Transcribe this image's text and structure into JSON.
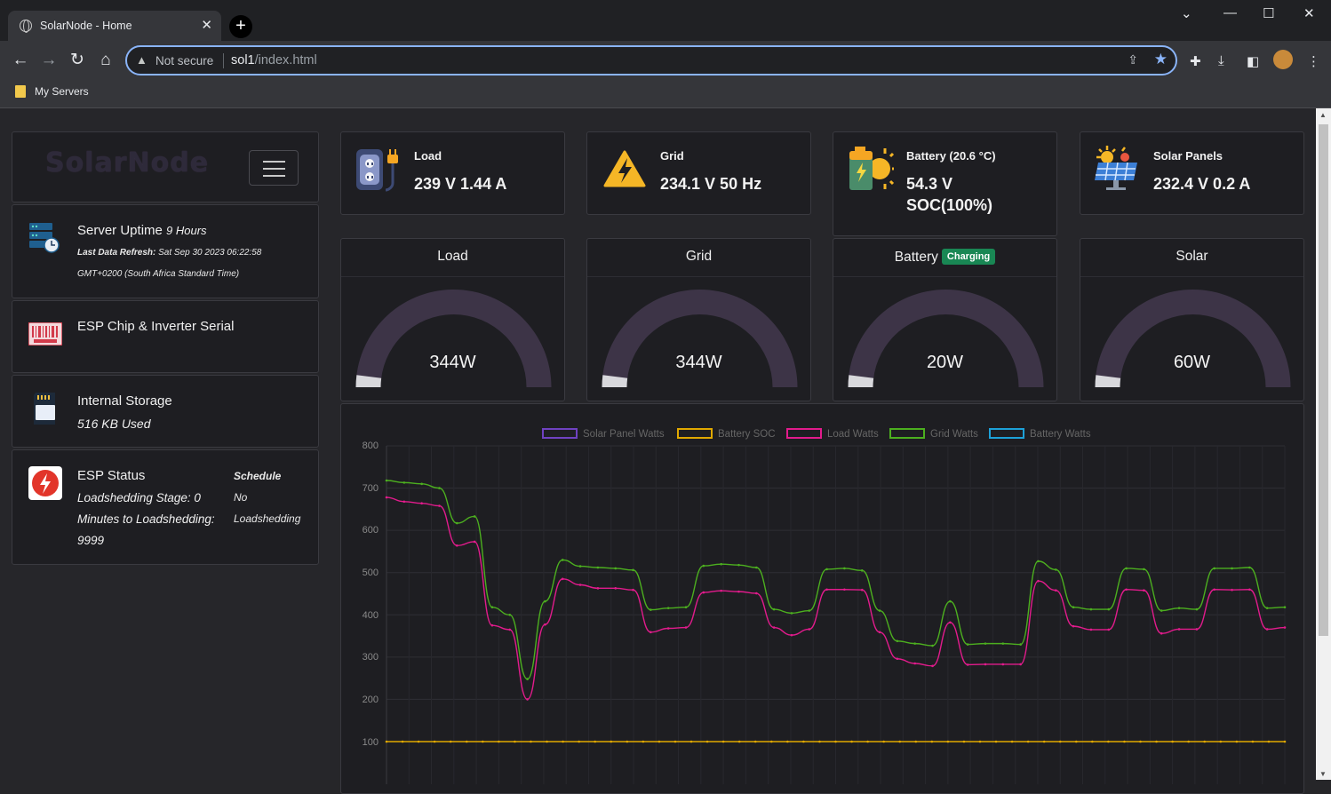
{
  "browser": {
    "tab_title": "SolarNode - Home",
    "tab_close": "✕",
    "new_tab": "+",
    "address_not_secure": "Not secure",
    "address_host": "sol1",
    "address_path": "/index.html",
    "bookmark_label": "My Servers"
  },
  "sidebar": {
    "logo_text": "SolarNode",
    "uptime_label": "Server Uptime",
    "uptime_value": "9 Hours",
    "refresh_label": "Last Data Refresh:",
    "refresh_value": "Sat Sep 30 2023 06:22:58",
    "refresh_tz": "GMT+0200 (South Africa Standard Time)",
    "esp_serial_label": "ESP Chip & Inverter Serial",
    "storage_label": "Internal Storage",
    "storage_value": "516 KB Used",
    "esp_status_label": "ESP Status",
    "loadshedding_stage": "Loadshedding Stage: 0",
    "minutes_label": "Minutes to Loadshedding:",
    "minutes_value": "9999",
    "schedule_label": "Schedule",
    "schedule_value_1": "No",
    "schedule_value_2": "Loadshedding"
  },
  "kpis": [
    {
      "label": "Load",
      "value": "239 V 1.44 A",
      "icon": "plug-outlet-icon"
    },
    {
      "label": "Grid",
      "value": "234.1 V 50 Hz",
      "icon": "high-voltage-icon"
    },
    {
      "label": "Battery (20.6 °C)",
      "value_line1": "54.3 V",
      "value_line2": "SOC(100%)",
      "icon": "battery-sun-icon"
    },
    {
      "label": "Solar Panels",
      "value": "232.4 V 0.2 A",
      "icon": "solar-panel-icon"
    }
  ],
  "gauges": [
    {
      "title": "Load",
      "value_text": "344W",
      "level": 0.0
    },
    {
      "title": "Grid",
      "value_text": "344W",
      "level": 0.0
    },
    {
      "title": "Battery",
      "badge": "Charging",
      "value_text": "20W",
      "level": 0.0
    },
    {
      "title": "Solar",
      "value_text": "60W",
      "level": 0.0
    }
  ],
  "colors": {
    "gauge_track": "#3d3447",
    "solar": "#6f42c1",
    "battery_soc": "#e0a800",
    "load": "#e21b8c",
    "grid": "#4caf1f",
    "battery_watts": "#1da1d8",
    "charging_badge": "#198754"
  },
  "chart_data": {
    "type": "line",
    "ylim": [
      0,
      800
    ],
    "yticks": [
      "800",
      "700",
      "600",
      "500",
      "400",
      "300",
      "200",
      "100"
    ],
    "legend_placement": "top",
    "grid": true,
    "series": [
      {
        "name": "Solar Panel Watts",
        "values": []
      },
      {
        "name": "Battery SOC",
        "values": [
          100,
          100,
          100,
          100,
          100,
          100,
          100,
          100,
          100,
          100,
          100,
          100,
          100,
          100,
          100,
          100,
          100,
          100,
          100,
          100,
          100,
          100,
          100,
          100,
          100,
          100,
          100,
          100,
          100,
          100,
          100,
          100,
          100,
          100,
          100,
          100,
          100,
          100,
          100,
          100,
          100,
          100,
          100,
          100,
          100,
          100,
          100,
          100,
          100,
          100,
          100,
          100,
          100,
          100,
          100,
          100,
          100
        ]
      },
      {
        "name": "Load Watts",
        "values": [
          678,
          668,
          664,
          658,
          564,
          573,
          375,
          365,
          200,
          377,
          485,
          471,
          463,
          463,
          459,
          359,
          368,
          370,
          453,
          457,
          455,
          451,
          370,
          352,
          366,
          460,
          460,
          459,
          359,
          296,
          285,
          279,
          382,
          282,
          283,
          283,
          283,
          480,
          458,
          373,
          365,
          365,
          460,
          458,
          356,
          366,
          366,
          460,
          459,
          460,
          366,
          370
        ]
      },
      {
        "name": "Grid Watts",
        "values": [
          718,
          713,
          710,
          700,
          617,
          633,
          418,
          400,
          248,
          432,
          530,
          515,
          512,
          510,
          506,
          412,
          416,
          418,
          516,
          520,
          518,
          512,
          413,
          404,
          410,
          508,
          510,
          505,
          410,
          338,
          332,
          327,
          432,
          330,
          332,
          332,
          330,
          527,
          507,
          418,
          413,
          413,
          510,
          508,
          410,
          416,
          413,
          510,
          510,
          512,
          416,
          418
        ]
      },
      {
        "name": "Battery Watts",
        "values": []
      }
    ]
  }
}
